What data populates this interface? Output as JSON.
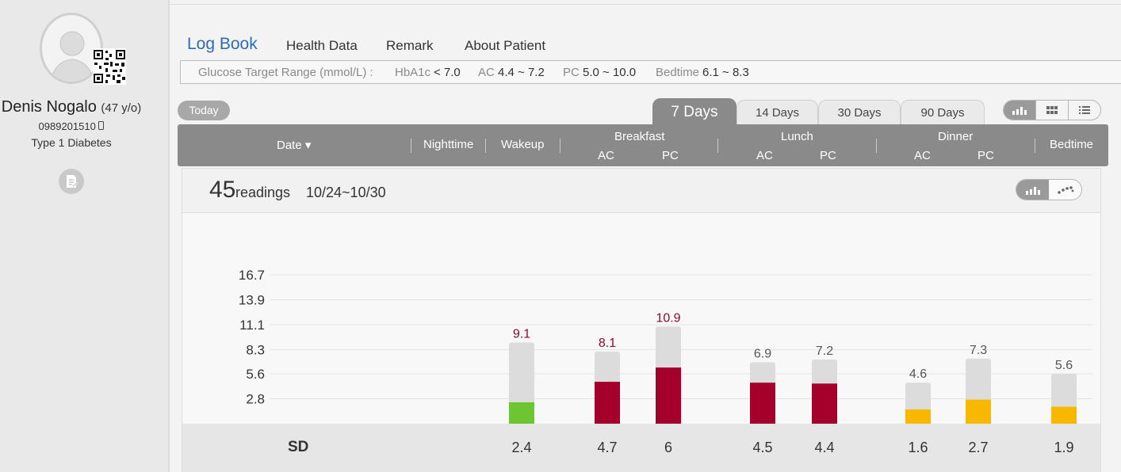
{
  "patient": {
    "name": "Denis Nogalo",
    "age": "(47 y/o)",
    "phone": "0989201510",
    "diabetes_type": "Type 1 Diabetes"
  },
  "nav": {
    "logbook": "Log Book",
    "health_data": "Health Data",
    "remark": "Remark",
    "about_patient": "About Patient"
  },
  "target": {
    "label": "Glucose Target Range (mmol/L) :",
    "hba1c_label": "HbA1c",
    "hba1c_value": "< 7.0",
    "ac_label": "AC",
    "ac_value": "4.4 ~ 7.2",
    "pc_label": "PC",
    "pc_value": "5.0 ~ 10.0",
    "bedtime_label": "Bedtime",
    "bedtime_value": "6.1 ~ 8.3"
  },
  "today_button": "Today",
  "tabs": [
    "7 Days",
    "14 Days",
    "30 Days",
    "90 Days"
  ],
  "active_tab": "7 Days",
  "table_header": {
    "date": "Date ▾",
    "nighttime": "Nighttime",
    "wakeup": "Wakeup",
    "breakfast": "Breakfast",
    "lunch": "Lunch",
    "dinner": "Dinner",
    "ac": "AC",
    "pc": "PC",
    "bedtime": "Bedtime"
  },
  "summary": {
    "count": "45",
    "count_label": "readings",
    "date_range": "10/24~10/30"
  },
  "colors": {
    "green": "#6cc531",
    "red": "#a5002b",
    "yellow": "#f8b800",
    "gray_bar": "#dcdcdc",
    "red_label": "#8b0a2e",
    "gray_label": "#555555"
  },
  "chart_data": {
    "type": "bar",
    "y_ticks": [
      "16.7",
      "13.9",
      "11.1",
      "8.3",
      "5.6",
      "2.8"
    ],
    "ylim": [
      0,
      16.7
    ],
    "series": [
      {
        "slot": "Wakeup",
        "max": 9.1,
        "mean": 2.4,
        "sd": "2.4",
        "label": "9.1",
        "color": "green",
        "label_color": "red"
      },
      {
        "slot": "Breakfast AC",
        "max": 8.1,
        "mean": 4.7,
        "sd": "4.7",
        "label": "8.1",
        "color": "red",
        "label_color": "red"
      },
      {
        "slot": "Breakfast PC",
        "max": 10.9,
        "mean": 6.3,
        "sd": "6",
        "label": "10.9",
        "color": "red",
        "label_color": "red"
      },
      {
        "slot": "Lunch AC",
        "max": 6.9,
        "mean": 4.6,
        "sd": "4.5",
        "label": "6.9",
        "color": "red",
        "label_color": "gray"
      },
      {
        "slot": "Lunch PC",
        "max": 7.2,
        "mean": 4.5,
        "sd": "4.4",
        "label": "7.2",
        "color": "red",
        "label_color": "gray"
      },
      {
        "slot": "Dinner AC",
        "max": 4.6,
        "mean": 1.6,
        "sd": "1.6",
        "label": "4.6",
        "color": "yellow",
        "label_color": "gray"
      },
      {
        "slot": "Dinner PC",
        "max": 7.3,
        "mean": 2.7,
        "sd": "2.7",
        "label": "7.3",
        "color": "yellow",
        "label_color": "gray"
      },
      {
        "slot": "Bedtime",
        "max": 5.6,
        "mean": 1.9,
        "sd": "1.9",
        "label": "5.6",
        "color": "yellow",
        "label_color": "gray"
      }
    ],
    "sd_label": "SD"
  }
}
